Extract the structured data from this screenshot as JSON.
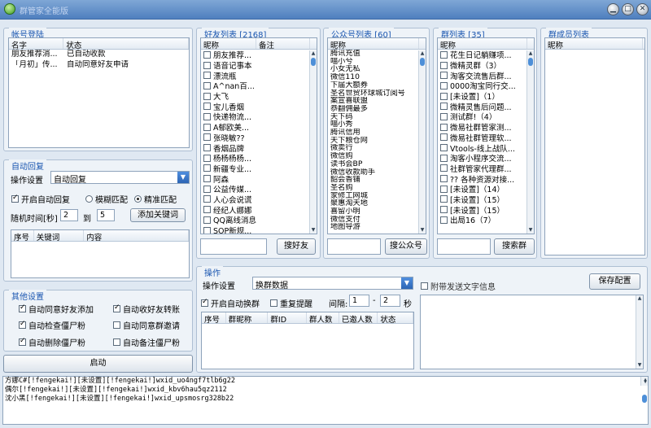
{
  "window": {
    "title": "群管家全能版"
  },
  "account": {
    "legend": "帐号登陆",
    "headers": [
      "名字",
      "状态"
    ],
    "rows": [
      [
        "朋友推荐消...",
        "已自动收款"
      ],
      [
        "「月初」传...",
        "自动同意好友申请"
      ]
    ]
  },
  "auto_reply": {
    "legend": "自动回复",
    "op_label": "操作设置",
    "op_value": "自动回复",
    "enable_label": "开启自动回复",
    "fuzzy_label": "模糊匹配",
    "exact_label": "精准匹配",
    "random_label": "随机时间[秒]",
    "from_value": "2",
    "to_label": "到",
    "to_value": "5",
    "add_keyword_label": "添加关键词",
    "headers": [
      "序号",
      "关键词",
      "内容"
    ]
  },
  "other": {
    "legend": "其他设置",
    "options": [
      {
        "label": "自动同意好友添加",
        "checked": true
      },
      {
        "label": "自动收好友转账",
        "checked": true
      },
      {
        "label": "自动检查僵尸粉",
        "checked": true
      },
      {
        "label": "自动同意群邀请",
        "checked": false
      },
      {
        "label": "自动删除僵尸粉",
        "checked": true
      },
      {
        "label": "自动备注僵尸粉",
        "checked": false
      }
    ],
    "start_label": "启动"
  },
  "friends": {
    "legend": "好友列表 [2168]",
    "headers": [
      "昵称",
      "备注"
    ],
    "items": [
      "朋友推荐...",
      "语音记事本",
      "漂流瓶",
      "A^nan百...",
      "大飞",
      "宝儿香烟",
      "快递物流...",
      "A郁欧美...",
      "张晓敏??",
      "香烟品牌",
      "杨杨杨杨...",
      "新疆专业...",
      "阿森",
      "公益传媒...",
      "人心会说谎",
      "经纪人娜娜",
      "QQ离线消息",
      "SOP新规..."
    ],
    "search_label": "搜好友"
  },
  "official": {
    "legend": "公众号列表 [60]",
    "header": "昵称",
    "items": [
      "腾讯充值",
      "喵小兮",
      "小女无私",
      "微信110",
      "下届大额券",
      "圣名世贸环球城订阅号",
      "案宣喜联盟",
      "恭翻佣最多",
      "天下码",
      "喵小秀",
      "腾讯信用",
      "天下粮仓网",
      "微卖行",
      "微信购",
      "读书会BP",
      "微信收款助手",
      "韶会香铺",
      "圣名购",
      "家修工网城",
      "聚惠淘天地",
      "喜留小明",
      "微信支付",
      "地图导游"
    ],
    "search_label": "搜公众号"
  },
  "groups": {
    "legend": "群列表 [35]",
    "header": "昵称",
    "items": [
      "花生日记躺赚项...",
      "微精灵群（3）",
      "淘客交流售后群...",
      "0000淘宝同行交...",
      "[未设置]（1）",
      "微精灵售后问题...",
      "测试群!（4）",
      "微易社群管家测...",
      "微易社群管理软...",
      "Vtools-线上战队...",
      "淘客小程序交流...",
      "社群管家代理群...",
      "?? 各种资源对接...",
      "[未设置]（14）",
      "[未设置]（15）",
      "[未设置]（15）",
      "出局16（7）"
    ],
    "search_label": "搜索群"
  },
  "members": {
    "legend": "群成员列表",
    "header": "昵称"
  },
  "operation": {
    "legend": "操作",
    "op_label": "操作设置",
    "op_value": "换群数据",
    "attach_label": "附带发送文字信息",
    "save_label": "保存配置",
    "auto_switch_label": "开启自动换群",
    "repeat_label": "重复提醒",
    "interval_label": "间隔:",
    "interval_from": "1",
    "interval_to": "2",
    "seconds_label": "秒",
    "headers": [
      "序号",
      "群昵称",
      "群ID",
      "群人数",
      "已邀人数",
      "状态"
    ]
  },
  "log": {
    "lines": [
      "方娜C#[!fengekai!][未设置][!fengekai!]wxid_uo4ngf7tlb6g22",
      "偶尔[!fengekai!][未设置][!fengekai!]wxid_kbv6hau5qz2112",
      "沈小黑[!fengekai!][未设置][!fengekai!]wxid_upsmosrg328b22"
    ]
  }
}
